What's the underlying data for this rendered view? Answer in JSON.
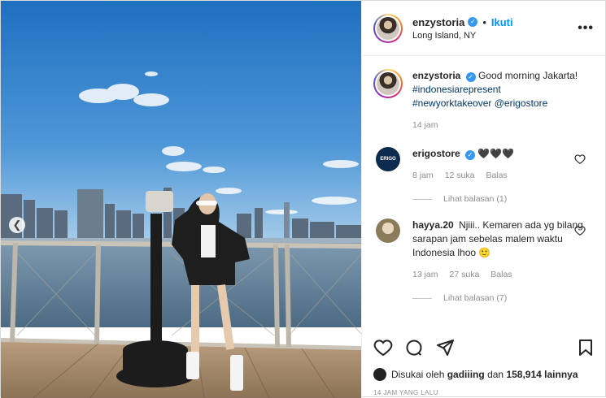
{
  "post": {
    "username": "enzystoria",
    "follow_label": "Ikuti",
    "location": "Long Island, NY",
    "more_label": "•••",
    "caption": {
      "text": "Good morning Jakarta!",
      "tags": [
        "#indonesiarepresent",
        "#newyorktakeover @erigostore"
      ],
      "time": "14 jam"
    },
    "comments": [
      {
        "username": "erigostore",
        "avatar_text": "ERIGO",
        "text": "🖤🖤🖤",
        "time": "8 jam",
        "likes": "12 suka",
        "reply_label": "Balas",
        "view_replies": "Lihat balasan (1)"
      },
      {
        "username": "hayya.20",
        "text": "Njiii.. Kemaren ada yg bilang sarapan jam sebelas malem waktu Indonesia lhoo 🙂",
        "time": "13 jam",
        "likes": "27 suka",
        "reply_label": "Balas",
        "view_replies": "Lihat balasan (7)"
      }
    ],
    "likes_line": {
      "prefix": "Disukai oleh",
      "user": "gadiiing",
      "conj": "dan",
      "count": "158,914 lainnya"
    },
    "timestamp": "14 JAM YANG LALU"
  },
  "colors": {
    "accent": "#0095f6",
    "verified": "#3897f0"
  },
  "icons": [
    "verified-icon",
    "more-icon",
    "heart-icon",
    "comment-icon",
    "share-icon",
    "bookmark-icon",
    "chevron-left-icon"
  ]
}
